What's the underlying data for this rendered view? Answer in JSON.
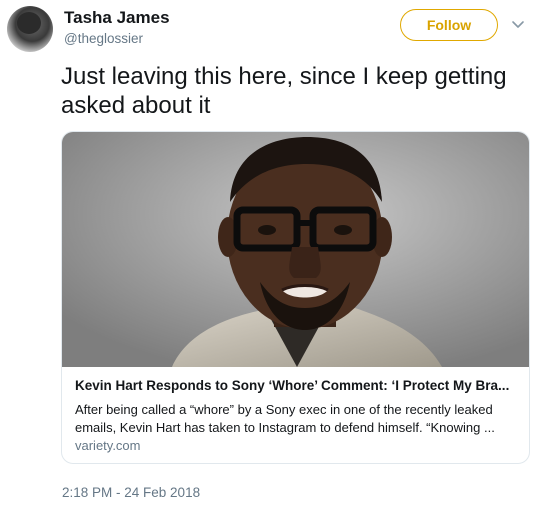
{
  "user": {
    "display_name": "Tasha James",
    "handle": "@theglossier"
  },
  "actions": {
    "follow_label": "Follow"
  },
  "tweet": {
    "text": "Just leaving this here, since I keep getting asked about it",
    "timestamp": "2:18 PM - 24 Feb 2018"
  },
  "card": {
    "title": "Kevin Hart Responds to Sony ‘Whore’ Comment: ‘I Protect My Bra...",
    "description": "After being called a “whore” by a Sony exec in one of the recently leaked emails, Kevin Hart has taken to Instagram to defend himself. “Knowing ...",
    "domain": "variety.com"
  },
  "colors": {
    "follow_accent": "#e0a800",
    "secondary_text": "#657786",
    "border": "#e1e8ed"
  },
  "icons": {
    "more": "chevron-down-icon"
  }
}
